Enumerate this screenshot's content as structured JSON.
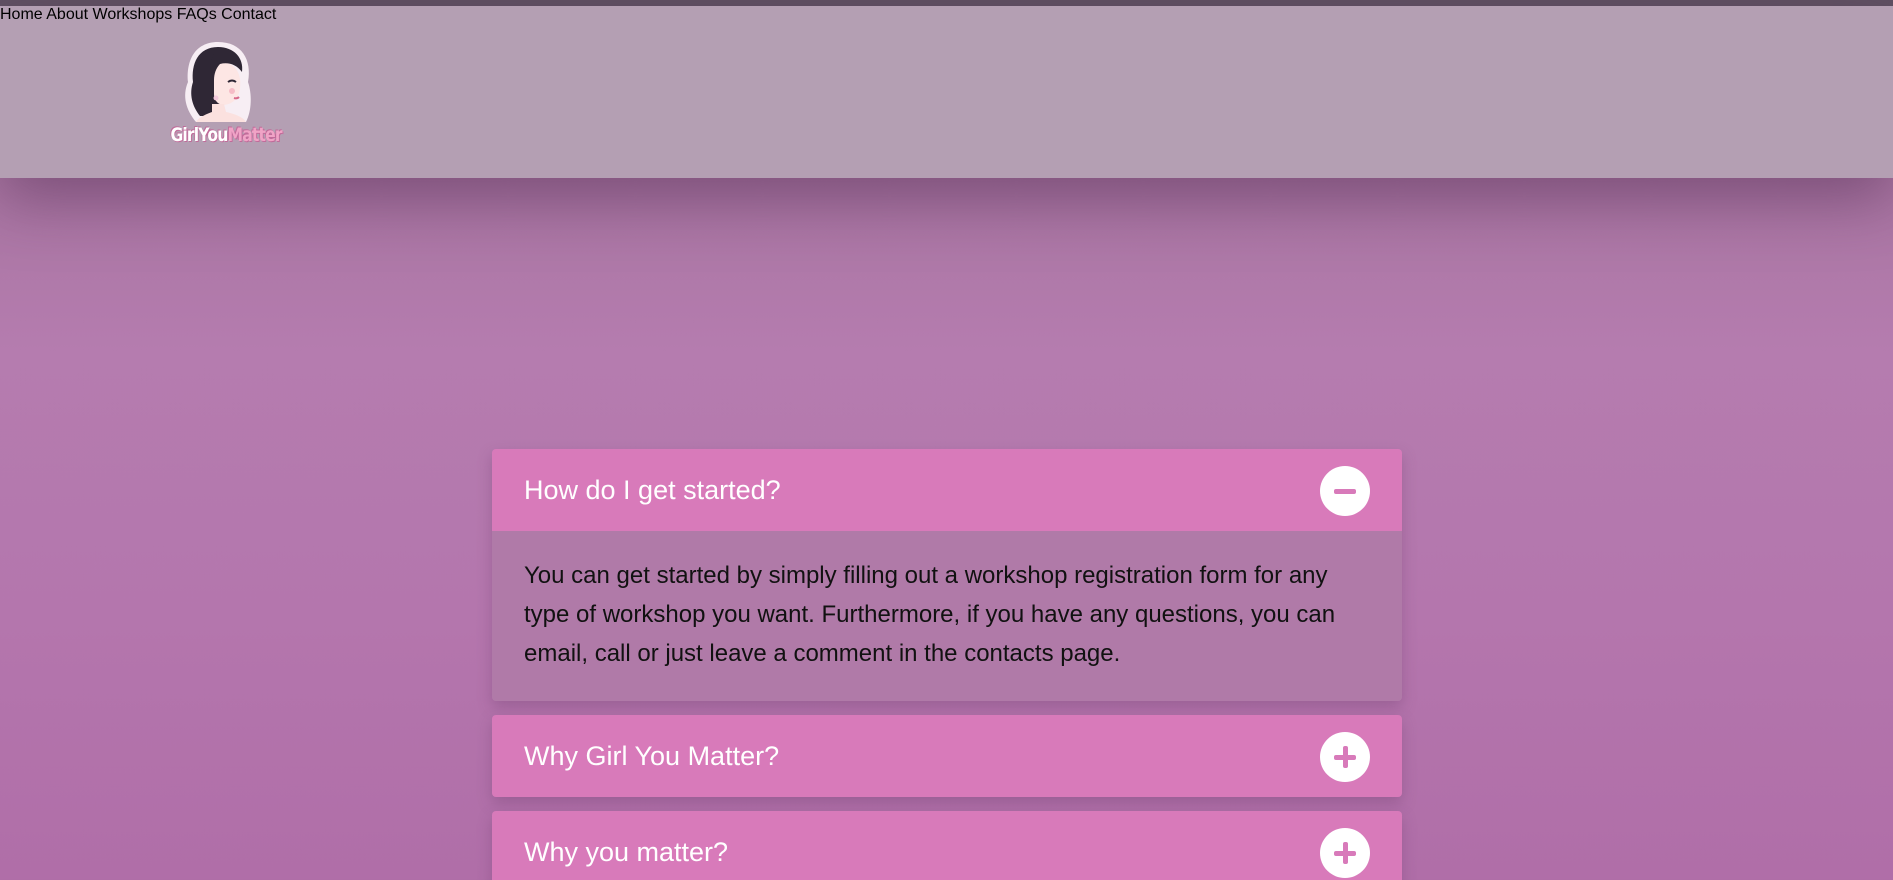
{
  "brand": {
    "logo_text_part1": "GirlYou",
    "logo_text_part2": "Matter",
    "logo_icon": "girl-portrait-icon"
  },
  "nav": {
    "items": [
      {
        "label": "Home"
      },
      {
        "label": "About"
      },
      {
        "label": "Workshops"
      },
      {
        "label": "FAQs"
      },
      {
        "label": "Contact"
      }
    ]
  },
  "faq": {
    "items": [
      {
        "question": "How do I get started?",
        "expanded": true,
        "toggle_icon": "minus-icon",
        "answer": "You can get started by simply filling out a workshop registration form for any type of workshop you want. Furthermore, if you have any questions, you can email, call or just leave a comment in the contacts page."
      },
      {
        "question": "Why Girl You Matter?",
        "expanded": false,
        "toggle_icon": "plus-icon"
      },
      {
        "question": "Why you matter?",
        "expanded": false,
        "toggle_icon": "plus-icon"
      }
    ]
  },
  "colors": {
    "header_bg": "#b49fb3",
    "nav_link": "#a6419b",
    "accordion_header": "#d87aba",
    "accordion_body": "#b07aa8",
    "page_bg": "#b57caf"
  }
}
